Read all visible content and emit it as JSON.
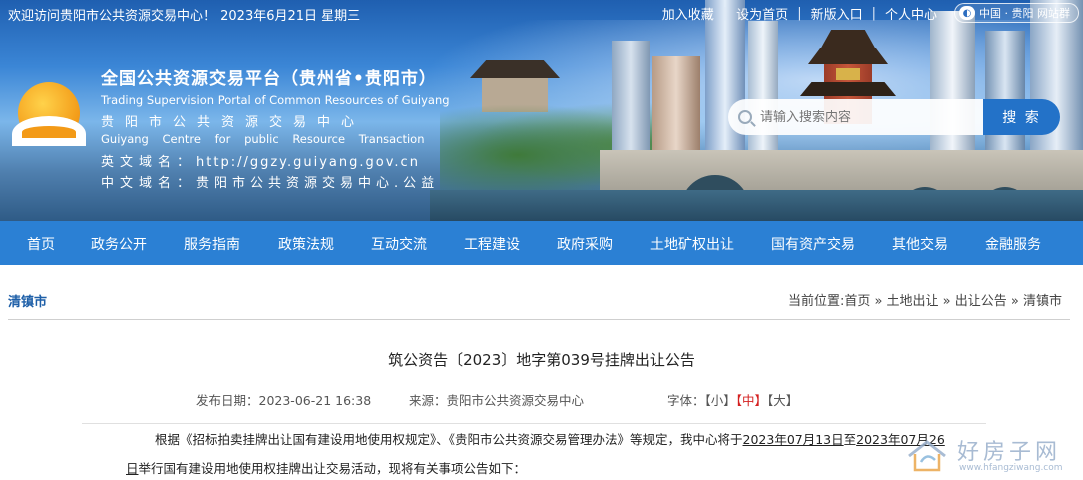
{
  "topbar": {
    "welcome": "欢迎访问贵阳市公共资源交易中心！ 2023年6月21日 星期三",
    "links": [
      "加入收藏",
      "设为首页",
      "新版入口",
      "个人中心"
    ],
    "station_label": "中国 · 贵阳   网站群"
  },
  "header": {
    "title_cn": "全国公共资源交易平台（贵州省•贵阳市）",
    "title_en": "Trading Supervision Portal of Common Resources of Guiyang",
    "org_cn": "贵阳市公共资源交易中心",
    "org_en": "Guiyang Centre for public Resource Transaction",
    "en_domain_key": "英文域名：",
    "en_domain_val": "http://ggzy.guiyang.gov.cn",
    "cn_domain_key": "中文域名：",
    "cn_domain_val": "贵阳市公共资源交易中心.公益"
  },
  "search": {
    "placeholder": "请输入搜索内容",
    "button": "搜 索"
  },
  "nav": {
    "items": [
      "首页",
      "政务公开",
      "服务指南",
      "政策法规",
      "互动交流",
      "工程建设",
      "政府采购",
      "土地矿权出让",
      "国有资产交易",
      "其他交易",
      "金融服务"
    ]
  },
  "breadcrumb": {
    "section": "清镇市",
    "trail": "当前位置:首页 » 土地出让 » 出让公告 » 清镇市"
  },
  "article": {
    "title": "筑公资告〔2023〕地字第039号挂牌出让公告",
    "date": "发布日期：2023-06-21 16:38",
    "source": "来源：贵阳市公共资源交易中心",
    "font_label": "字体：",
    "font_small": "【小】",
    "font_mid": "【中】",
    "font_large": "【大】",
    "para1_a": "根据《招标拍卖挂牌出让国有建设用地使用权规定》、《贵阳市公共资源交易管理办法》等规定，我中心将于",
    "para1_date1": "2023年07月13日",
    "para1_to": "至",
    "para1_date2": "2023年07月26",
    "para2_day": "日",
    "para2_rest": "举行国有建设用地使用权挂牌出让交易活动，现将有关事项公告如下："
  },
  "watermark": {
    "text": "好房子网",
    "url": "www.hfangziwang.com"
  },
  "colors": {
    "nav_bg": "#2b80d4",
    "section_title": "#1e5fa8",
    "font_mid_active": "#d42020",
    "search_button": "#2372c8"
  }
}
